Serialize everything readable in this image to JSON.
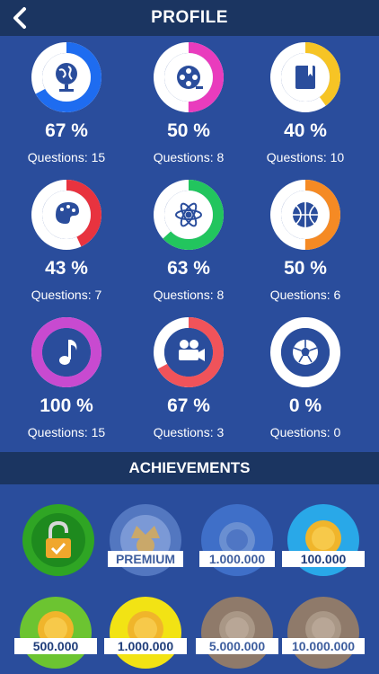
{
  "header": {
    "title": "PROFILE"
  },
  "categories": [
    {
      "icon": "globe-icon",
      "percent_text": "67 %",
      "percent": 67,
      "questions_text": "Questions: 15",
      "color": "#1e6cf0"
    },
    {
      "icon": "film-reel-icon",
      "percent_text": "50 %",
      "percent": 50,
      "questions_text": "Questions: 8",
      "color": "#e93cbd"
    },
    {
      "icon": "book-icon",
      "percent_text": "40 %",
      "percent": 40,
      "questions_text": "Questions: 10",
      "color": "#f6c425"
    },
    {
      "icon": "palette-icon",
      "percent_text": "43 %",
      "percent": 43,
      "questions_text": "Questions: 7",
      "color": "#e8333f"
    },
    {
      "icon": "atom-icon",
      "percent_text": "63 %",
      "percent": 63,
      "questions_text": "Questions: 8",
      "color": "#22c55e"
    },
    {
      "icon": "basketball-icon",
      "percent_text": "50 %",
      "percent": 50,
      "questions_text": "Questions: 6",
      "color": "#f58a24"
    },
    {
      "icon": "music-note-icon",
      "percent_text": "100 %",
      "percent": 100,
      "questions_text": "Questions: 15",
      "color": "#c84ad0"
    },
    {
      "icon": "movie-camera-icon",
      "percent_text": "67 %",
      "percent": 67,
      "questions_text": "Questions: 3",
      "color": "#f0535a"
    },
    {
      "icon": "soccer-ball-icon",
      "percent_text": "0 %",
      "percent": 0,
      "questions_text": "Questions: 0",
      "color": "#ffffff"
    }
  ],
  "achievements": {
    "title": "ACHIEVEMENTS",
    "badges": [
      {
        "icon": "unlocked-padlock-icon",
        "label": "",
        "color": "#2fa524",
        "state": "earned"
      },
      {
        "icon": "crown-icon",
        "label": "PREMIUM",
        "color": "#5b7fc7",
        "state": "locked"
      },
      {
        "icon": "coin-icon",
        "label": "1.000.000",
        "color": "#3f6fc8",
        "state": "locked"
      },
      {
        "icon": "coin-icon",
        "label": "100.000",
        "color": "#29a8e8",
        "state": "earned"
      },
      {
        "icon": "coin-icon",
        "label": "500.000",
        "color": "#6cc431",
        "state": "earned"
      },
      {
        "icon": "coin-icon",
        "label": "1.000.000",
        "color": "#f2e314",
        "state": "earned"
      },
      {
        "icon": "coin-icon",
        "label": "5.000.000",
        "color": "#8f7a6a",
        "state": "locked"
      },
      {
        "icon": "coin-icon",
        "label": "10.000.000",
        "color": "#8f7a6a",
        "state": "locked"
      }
    ]
  }
}
